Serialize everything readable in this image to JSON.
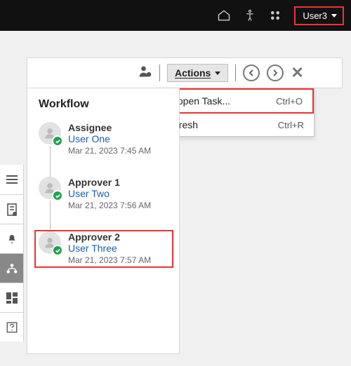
{
  "topbar": {
    "user_label": "User3"
  },
  "panel_toolbar": {
    "actions_label": "Actions"
  },
  "actions_menu": {
    "items": [
      {
        "label": "Reopen Task...",
        "shortcut": "Ctrl+O",
        "highlighted": true
      },
      {
        "label": "Refresh",
        "shortcut": "Ctrl+R",
        "highlighted": false
      }
    ]
  },
  "workflow": {
    "title": "Workflow",
    "steps": [
      {
        "role": "Assignee",
        "user": "User One",
        "time": "Mar 21, 2023 7:45 AM",
        "highlighted": false
      },
      {
        "role": "Approver 1",
        "user": "User Two",
        "time": "Mar 21, 2023 7:56 AM",
        "highlighted": false
      },
      {
        "role": "Approver 2",
        "user": "User Three",
        "time": "Mar 21, 2023 7:57 AM",
        "highlighted": true
      }
    ]
  }
}
